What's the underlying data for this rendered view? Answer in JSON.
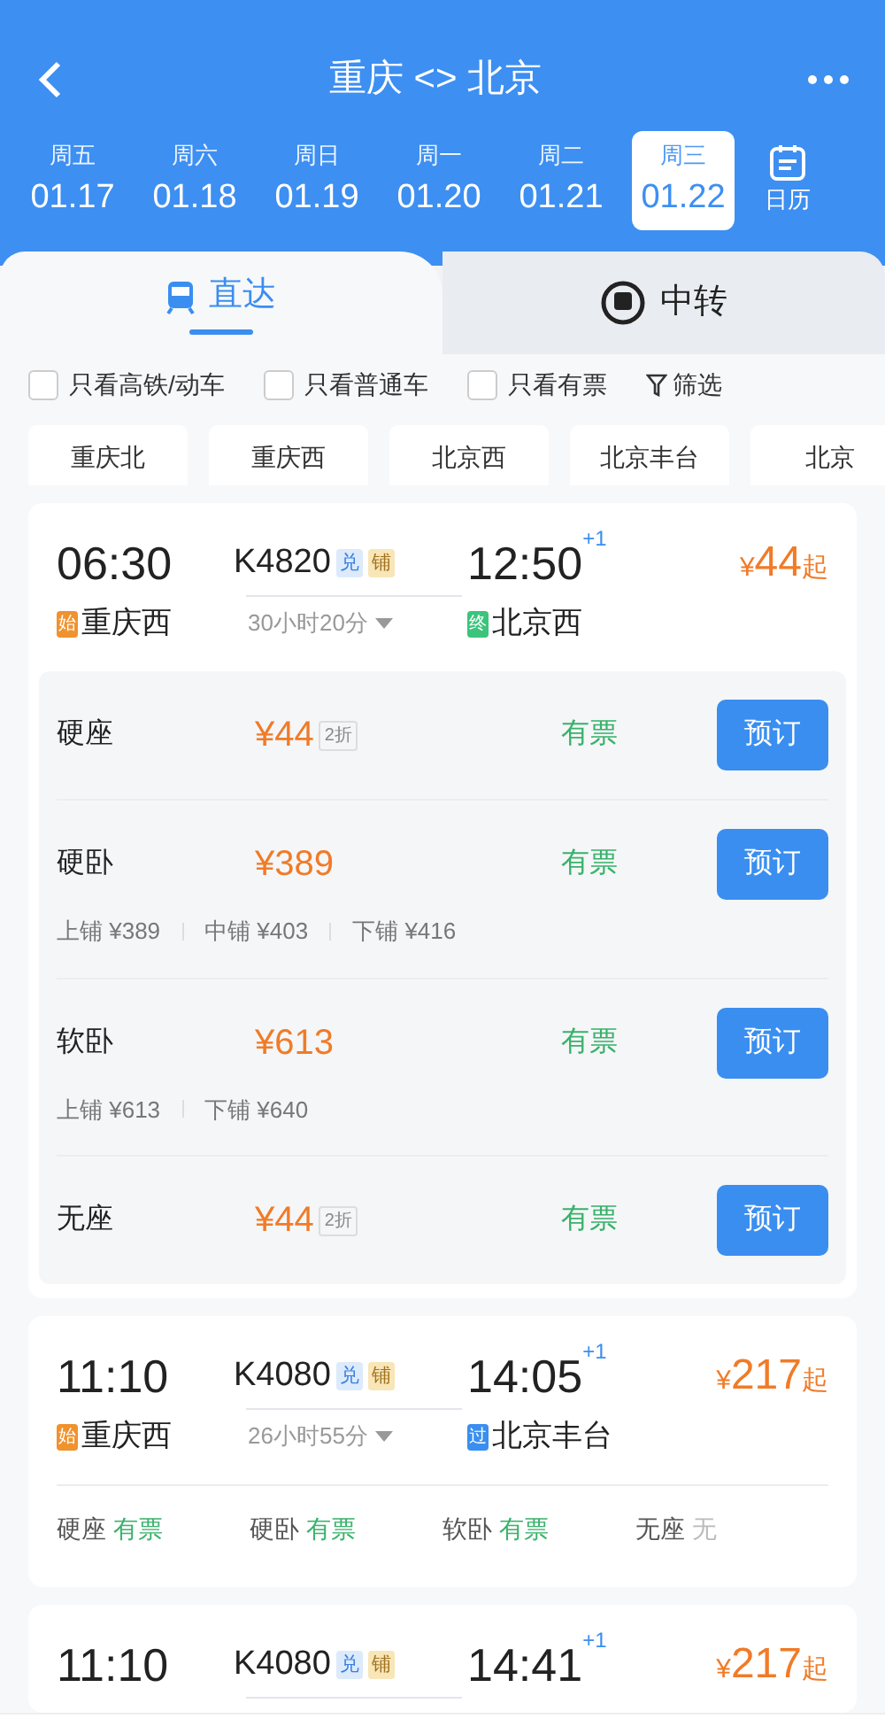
{
  "header": {
    "title": "重庆 <> 北京",
    "calendar_label": "日历"
  },
  "dates": [
    {
      "weekday": "周五",
      "date": "01.17",
      "selected": false
    },
    {
      "weekday": "周六",
      "date": "01.18",
      "selected": false
    },
    {
      "weekday": "周日",
      "date": "01.19",
      "selected": false
    },
    {
      "weekday": "周一",
      "date": "01.20",
      "selected": false
    },
    {
      "weekday": "周二",
      "date": "01.21",
      "selected": false
    },
    {
      "weekday": "周三",
      "date": "01.22",
      "selected": true
    }
  ],
  "tabs": [
    {
      "label": "直达",
      "kind": "direct",
      "selected": true
    },
    {
      "label": "中转",
      "kind": "transfer",
      "selected": false
    }
  ],
  "filters": [
    {
      "label": "只看高铁/动车",
      "checked": false
    },
    {
      "label": "只看普通车",
      "checked": false
    },
    {
      "label": "只看有票",
      "checked": false
    }
  ],
  "filter_button": "筛选",
  "stations": [
    "重庆北",
    "重庆西",
    "北京西",
    "北京丰台",
    "北京"
  ],
  "trains": [
    {
      "depart": "06:30",
      "train_no": "K4820",
      "badges": [
        {
          "text": "兑",
          "kind": "exchange"
        },
        {
          "text": "铺",
          "kind": "berth"
        }
      ],
      "arrive": "12:50",
      "day_offset": "+1",
      "currency": "¥",
      "price": "44",
      "price_suffix": "起",
      "from_tag": {
        "text": "始",
        "color": "#f0922e"
      },
      "from": "重庆西",
      "duration": "30小时20分",
      "to_tag": {
        "text": "终",
        "color": "#3cc47c"
      },
      "to": "北京西",
      "seats": [
        {
          "name": "硬座",
          "price": "¥44",
          "discount": "2折",
          "status": "有票",
          "book_label": "预订"
        },
        {
          "name": "硬卧",
          "price": "¥389",
          "status": "有票",
          "berths": [
            "上铺 ¥389",
            "中铺 ¥403",
            "下铺 ¥416"
          ],
          "book_label": "预订"
        },
        {
          "name": "软卧",
          "price": "¥613",
          "status": "有票",
          "berths": [
            "上铺 ¥613",
            "下铺 ¥640"
          ],
          "book_label": "预订"
        },
        {
          "name": "无座",
          "price": "¥44",
          "discount": "2折",
          "status": "有票",
          "book_label": "预订"
        }
      ]
    },
    {
      "depart": "11:10",
      "train_no": "K4080",
      "badges": [
        {
          "text": "兑",
          "kind": "exchange"
        },
        {
          "text": "铺",
          "kind": "berth"
        }
      ],
      "arrive": "14:05",
      "day_offset": "+1",
      "currency": "¥",
      "price": "217",
      "price_suffix": "起",
      "from_tag": {
        "text": "始",
        "color": "#f0922e"
      },
      "from": "重庆西",
      "duration": "26小时55分",
      "to_tag": {
        "text": "过",
        "color": "#3a8ef0"
      },
      "to": "北京丰台",
      "summary": [
        {
          "name": "硬座",
          "status": "有票",
          "available": true
        },
        {
          "name": "硬卧",
          "status": "有票",
          "available": true
        },
        {
          "name": "软卧",
          "status": "有票",
          "available": true
        },
        {
          "name": "无座",
          "status": "无",
          "available": false
        }
      ]
    },
    {
      "depart": "11:10",
      "train_no": "K4080",
      "badges": [
        {
          "text": "兑",
          "kind": "exchange"
        },
        {
          "text": "铺",
          "kind": "berth"
        }
      ],
      "arrive": "14:41",
      "day_offset": "+1",
      "currency": "¥",
      "price": "217",
      "price_suffix": "起"
    }
  ]
}
